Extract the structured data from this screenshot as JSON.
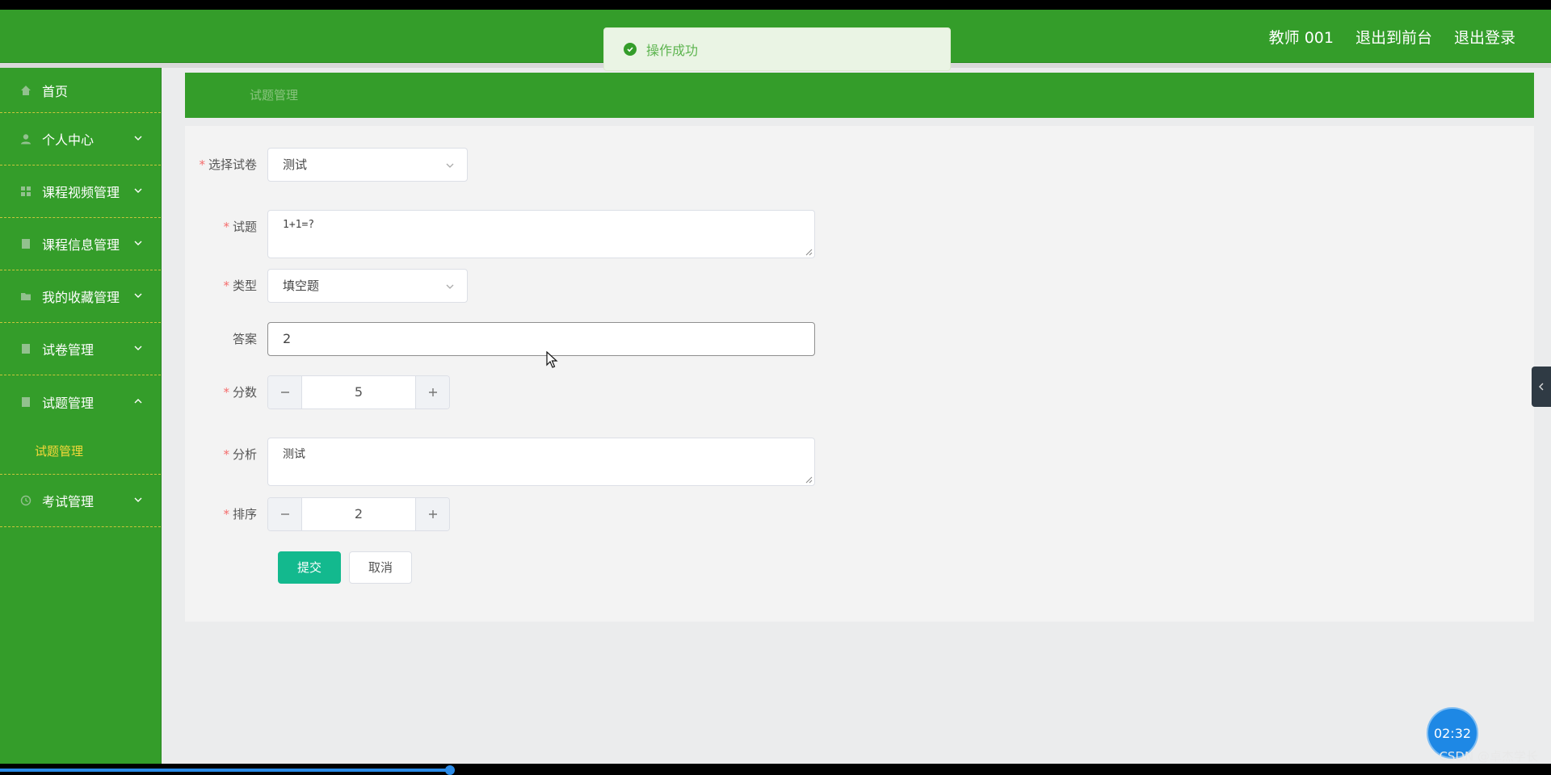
{
  "header": {
    "user": "教师 001",
    "to_front": "退出到前台",
    "logout": "退出登录"
  },
  "toast": {
    "message": "操作成功"
  },
  "sidebar": {
    "items": [
      {
        "label": "首页",
        "icon": "home-icon"
      },
      {
        "label": "个人中心",
        "icon": "user-icon"
      },
      {
        "label": "课程视频管理",
        "icon": "grid-icon"
      },
      {
        "label": "课程信息管理",
        "icon": "doc-icon"
      },
      {
        "label": "我的收藏管理",
        "icon": "folder-icon"
      },
      {
        "label": "试卷管理",
        "icon": "doc-icon"
      },
      {
        "label": "试题管理",
        "icon": "doc-icon"
      },
      {
        "label": "考试管理",
        "icon": "clock-icon"
      }
    ],
    "active_submenu": "试题管理"
  },
  "breadcrumb": {
    "title": "试题管理"
  },
  "form": {
    "paper": {
      "label": "选择试卷",
      "value": "测试"
    },
    "question": {
      "label": "试题",
      "value": "1+1=?"
    },
    "type": {
      "label": "类型",
      "value": "填空题"
    },
    "answer": {
      "label": "答案",
      "value": "2"
    },
    "score": {
      "label": "分数",
      "value": "5"
    },
    "analysis": {
      "label": "分析",
      "value": "测试"
    },
    "order": {
      "label": "排序",
      "value": "2"
    },
    "submit": "提交",
    "cancel": "取消"
  },
  "recorder": {
    "time": "02:32",
    "watermark": "CSDN @卓杰学长",
    "progress": 0.29
  },
  "colors": {
    "brand_green": "#349d2a",
    "primary_button": "#13b98e",
    "active_submenu": "#f5d83a",
    "required_star": "#f56c6c"
  }
}
